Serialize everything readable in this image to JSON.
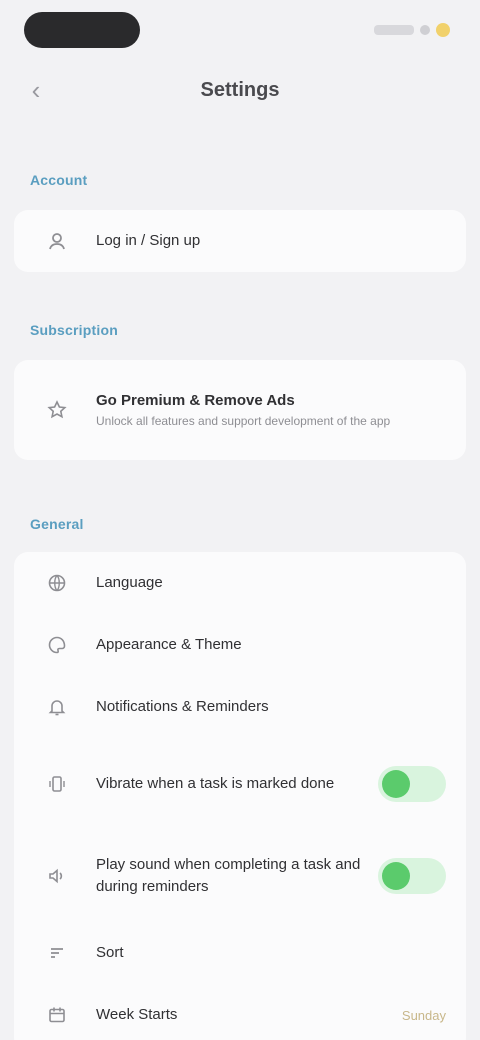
{
  "status_bar": {
    "icons": [
      "signal-icon",
      "battery-icon"
    ],
    "accent": "#f1d16b"
  },
  "nav": {
    "title": "Settings",
    "back_icon": "chevron-left-icon"
  },
  "sections": {
    "account": {
      "label": "Account",
      "items": [
        {
          "icon": "user-icon",
          "label": "Log in / Sign up"
        }
      ]
    },
    "subscription": {
      "label": "Subscription",
      "items": [
        {
          "icon": "star-icon",
          "label": "Go Premium & Remove Ads",
          "sub": "Unlock all features and support development of the app"
        }
      ]
    },
    "general": {
      "label": "General",
      "items": [
        {
          "icon": "globe-icon",
          "label": "Language"
        },
        {
          "icon": "palette-icon",
          "label": "Appearance & Theme"
        },
        {
          "icon": "bell-icon",
          "label": "Notifications & Reminders"
        },
        {
          "icon": "vibrate-icon",
          "label": "Vibrate when a task is marked done",
          "toggle": true,
          "toggle_on": true
        },
        {
          "icon": "sound-icon",
          "label": "Play sound when completing a task and during reminders",
          "toggle": true,
          "toggle_on": true
        },
        {
          "icon": "sort-icon",
          "label": "Sort"
        },
        {
          "icon": "calendar-icon",
          "label": "Week Starts",
          "value": "Sunday"
        }
      ]
    }
  },
  "colors": {
    "background": "#f2f2f4",
    "section_label": "#5a9ec0",
    "toggle_on": "#5bcb6c",
    "toggle_track": "#d9f4de"
  }
}
